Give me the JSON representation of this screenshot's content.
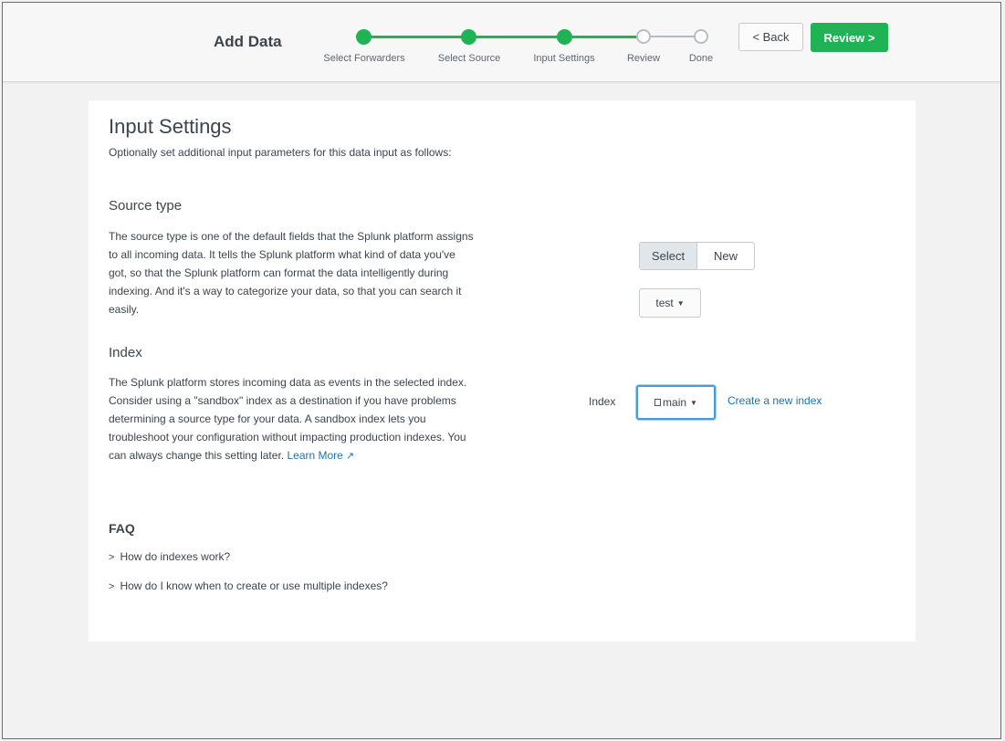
{
  "header": {
    "title": "Add Data",
    "back_label": "< Back",
    "review_label": "Review >",
    "steps": [
      {
        "label": "Select Forwarders",
        "state": "complete"
      },
      {
        "label": "Select Source",
        "state": "complete"
      },
      {
        "label": "Input Settings",
        "state": "current"
      },
      {
        "label": "Review",
        "state": "incomplete"
      },
      {
        "label": "Done",
        "state": "incomplete"
      }
    ]
  },
  "page": {
    "title": "Input Settings",
    "subtitle": "Optionally set additional input parameters for this data input as follows:"
  },
  "source_type": {
    "heading": "Source type",
    "description": "The source type is one of the default fields that the Splunk platform assigns to all incoming data. It tells the Splunk platform what kind of data you've got, so that the Splunk platform can format the data intelligently during indexing. And it's a way to categorize your data, so that you can search it easily.",
    "toggle_select": "Select",
    "toggle_new": "New",
    "selected_value": "test"
  },
  "index": {
    "heading": "Index",
    "description": "The Splunk platform stores incoming data as events in the selected index. Consider using a \"sandbox\" index as a destination if you have problems determining a source type for your data. A sandbox index lets you troubleshoot your configuration without impacting production indexes. You can always change this setting later.",
    "learn_more": "Learn More",
    "field_label": "Index",
    "selected_value": "main",
    "create_link": "Create a new index"
  },
  "faq": {
    "heading": "FAQ",
    "items": [
      "How do indexes work?",
      "How do I know when to create or use multiple indexes?"
    ]
  },
  "colors": {
    "accent_green": "#1fb356",
    "link_blue": "#1a73b5",
    "focus_blue": "#4a9ad8"
  }
}
